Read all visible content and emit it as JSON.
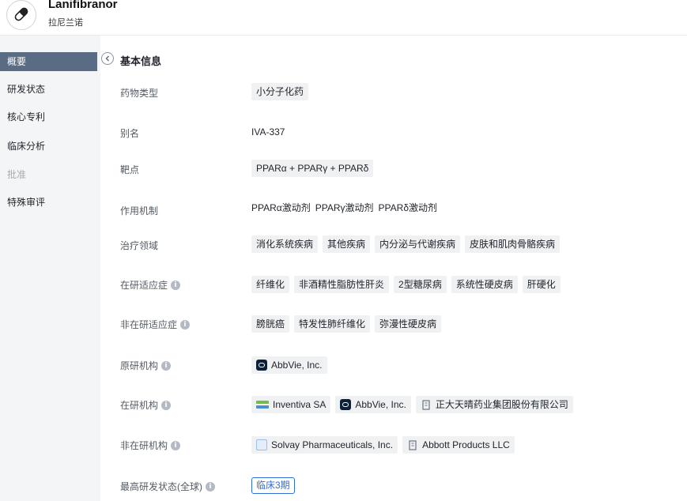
{
  "header": {
    "title": "Lanifibranor",
    "subtitle": "拉尼兰诺"
  },
  "sidebar": {
    "items": [
      {
        "label": "概要",
        "state": "active"
      },
      {
        "label": "研发状态",
        "state": "normal"
      },
      {
        "label": "核心专利",
        "state": "normal"
      },
      {
        "label": "临床分析",
        "state": "normal"
      },
      {
        "label": "批准",
        "state": "disabled"
      },
      {
        "label": "特殊审评",
        "state": "normal"
      }
    ]
  },
  "section": {
    "title": "基本信息"
  },
  "rows": {
    "drug_type": {
      "label": "药物类型",
      "tags": [
        "小分子化药"
      ]
    },
    "alias": {
      "label": "别名",
      "value": "IVA-337"
    },
    "target": {
      "label": "靶点",
      "tags": [
        "PPARα + PPARγ + PPARδ"
      ]
    },
    "mechanism": {
      "label": "作用机制",
      "items": [
        "PPARα激动剂",
        "PPARγ激动剂",
        "PPARδ激动剂"
      ]
    },
    "therapeutic_area": {
      "label": "治疗领域",
      "tags": [
        "消化系统疾病",
        "其他疾病",
        "内分泌与代谢疾病",
        "皮肤和肌肉骨骼疾病"
      ]
    },
    "active_indications": {
      "label": "在研适应症",
      "tags": [
        "纤维化",
        "非酒精性脂肪性肝炎",
        "2型糖尿病",
        "系统性硬皮病",
        "肝硬化"
      ]
    },
    "inactive_indications": {
      "label": "非在研适应症",
      "tags": [
        "膀胱癌",
        "特发性肺纤维化",
        "弥漫性硬皮病"
      ]
    },
    "originator": {
      "label": "原研机构",
      "orgs": [
        "AbbVie, Inc."
      ]
    },
    "active_orgs": {
      "label": "在研机构",
      "orgs": [
        "Inventiva SA",
        "AbbVie, Inc.",
        "正大天晴药业集团股份有限公司"
      ]
    },
    "inactive_orgs": {
      "label": "非在研机构",
      "orgs": [
        "Solvay Pharmaceuticals, Inc.",
        "Abbott Products LLC"
      ]
    },
    "highest_phase": {
      "label": "最高研发状态(全球)",
      "value": "临床3期",
      "color": "#2f6fd6"
    }
  },
  "colors": {
    "active_nav": "#5a6b84",
    "sidebar_bg": "#f4f5f7",
    "tag_bg": "#f0f1f3"
  },
  "icons": {
    "drug": "pill-icon",
    "collapse": "chevron-left-icon",
    "info": "info-icon"
  }
}
